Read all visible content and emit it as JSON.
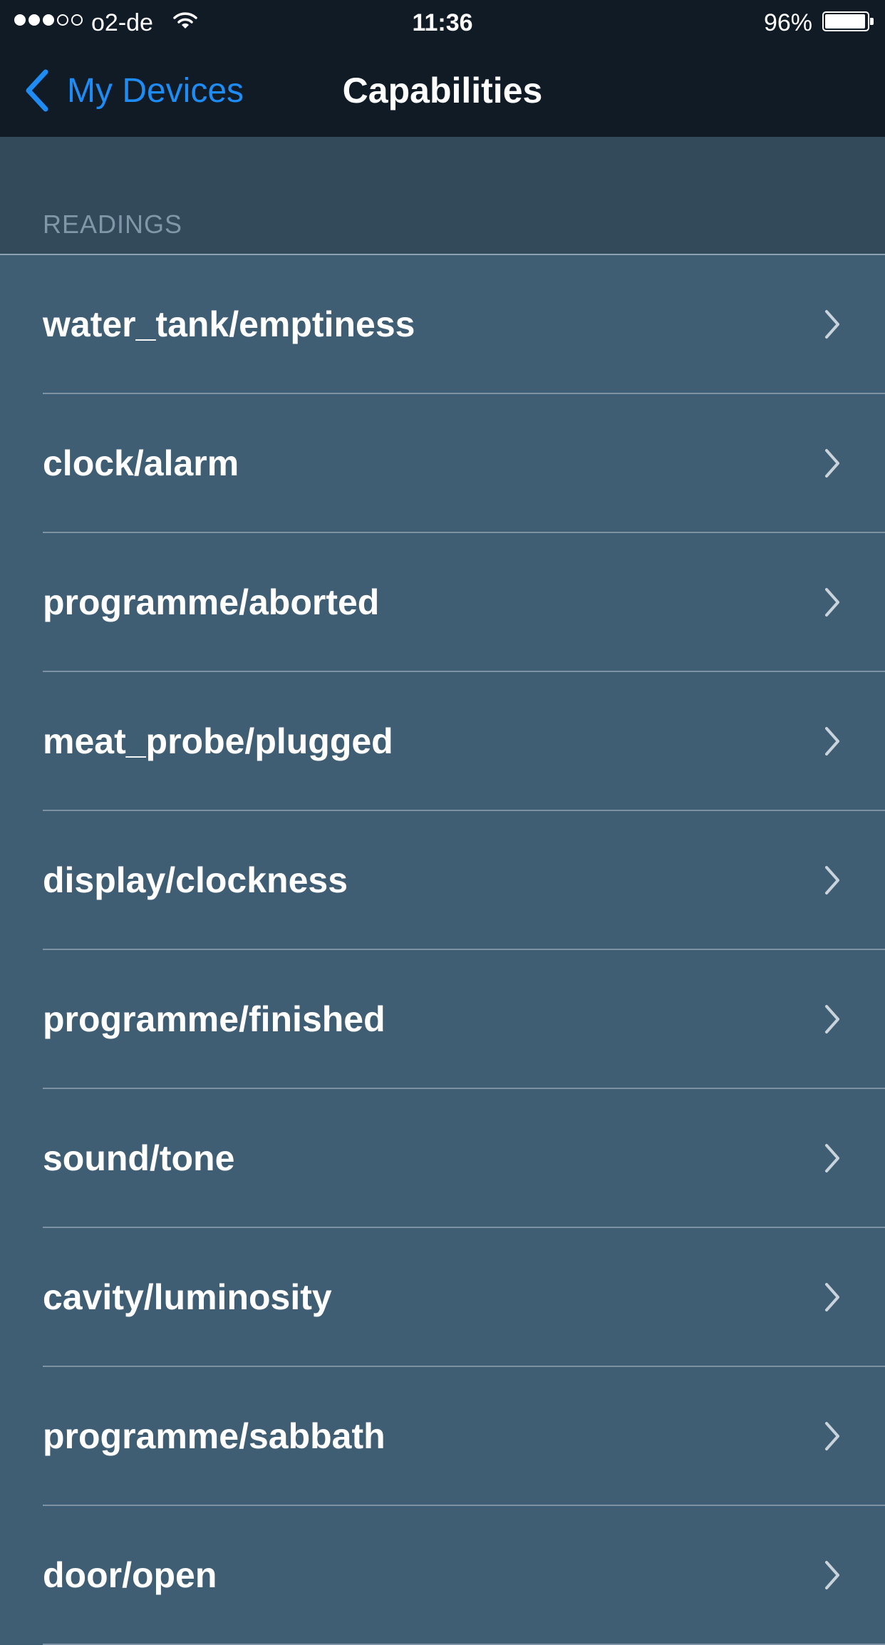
{
  "status_bar": {
    "carrier": "o2-de",
    "time": "11:36",
    "battery_percent": "96%",
    "battery_level": 0.96,
    "signal_bars_filled": 3,
    "signal_bars_total": 5
  },
  "nav": {
    "back_label": "My Devices",
    "title": "Capabilities"
  },
  "section": {
    "header": "READINGS"
  },
  "items": [
    {
      "label": "water_tank/emptiness"
    },
    {
      "label": "clock/alarm"
    },
    {
      "label": "programme/aborted"
    },
    {
      "label": "meat_probe/plugged"
    },
    {
      "label": "display/clockness"
    },
    {
      "label": "programme/finished"
    },
    {
      "label": "sound/tone"
    },
    {
      "label": "cavity/luminosity"
    },
    {
      "label": "programme/sabbath"
    },
    {
      "label": "door/open"
    }
  ],
  "colors": {
    "background": "#3f5e74",
    "nav_bar": "#101b26",
    "section_header_bg": "#334a5b",
    "accent": "#1e8cf5"
  }
}
